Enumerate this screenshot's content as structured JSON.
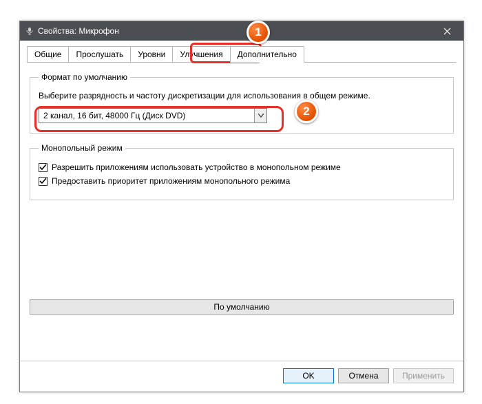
{
  "window": {
    "title": "Свойства: Микрофон"
  },
  "tabs": [
    {
      "label": "Общие"
    },
    {
      "label": "Прослушать"
    },
    {
      "label": "Уровни"
    },
    {
      "label": "Улучшения"
    },
    {
      "label": "Дополнительно",
      "active": true
    }
  ],
  "group_format": {
    "legend": "Формат по умолчанию",
    "hint": "Выберите разрядность и частоту дискретизации для использования в общем режиме.",
    "combo_value": "2 канал, 16 бит, 48000 Гц (Диск DVD)"
  },
  "group_exclusive": {
    "legend": "Монопольный режим",
    "allow_label": "Разрешить приложениям использовать устройство в монопольном режиме",
    "allow_checked": true,
    "priority_label": "Предоставить приоритет приложениям монопольного режима",
    "priority_checked": true
  },
  "default_button": "По умолчанию",
  "buttons": {
    "ok": "OK",
    "cancel": "Отмена",
    "apply": "Применить"
  },
  "annotations": {
    "b1": "1",
    "b2": "2"
  }
}
